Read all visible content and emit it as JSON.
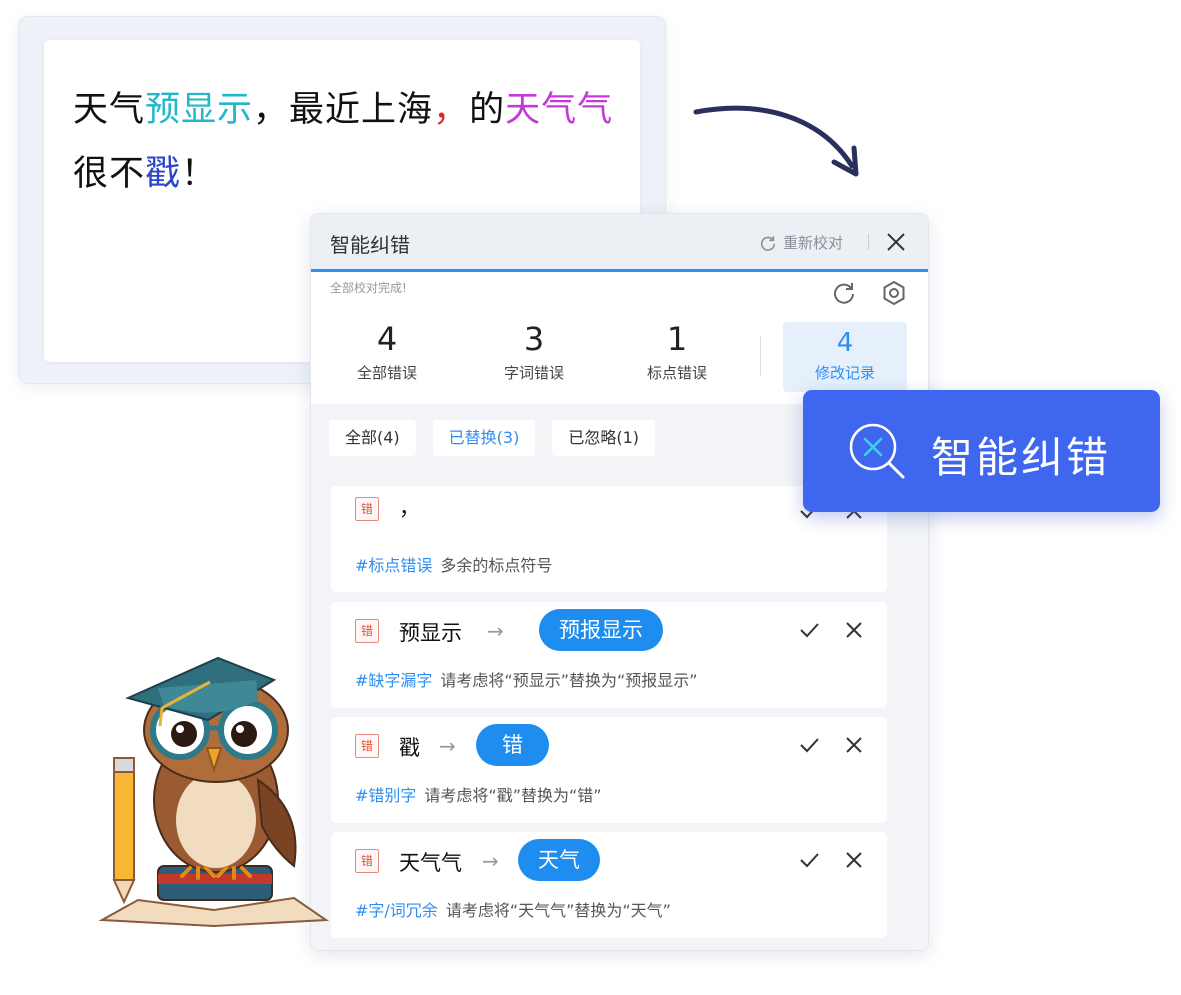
{
  "editor": {
    "seg1": "天气",
    "seg2": "预显示",
    "seg3": "，最近上海",
    "seg4": "，",
    "seg5": "的",
    "seg6": "天气气",
    "seg7": "很不",
    "seg8": "戳",
    "seg9": "！"
  },
  "panel": {
    "title": "智能纠错",
    "recheck_label": "重新校对",
    "status": "全部校对完成!",
    "stats": [
      {
        "num": "4",
        "label": "全部错误"
      },
      {
        "num": "3",
        "label": "字词错误"
      },
      {
        "num": "1",
        "label": "标点错误"
      },
      {
        "num": "4",
        "label": "修改记录"
      }
    ],
    "filters": [
      "全部(4)",
      "已替换(3)",
      "已忽略(1)"
    ],
    "items": [
      {
        "tag": "错",
        "original": "，",
        "suggestion": "",
        "category": "#标点错误",
        "description": "多余的标点符号"
      },
      {
        "tag": "错",
        "original": "预显示",
        "suggestion": "预报显示",
        "category": "#缺字漏字",
        "description": "请考虑将“预显示”替换为“预报显示”"
      },
      {
        "tag": "错",
        "original": "戳",
        "suggestion": "错",
        "category": "#错别字",
        "description": "请考虑将“戳”替换为“错”"
      },
      {
        "tag": "错",
        "original": "天气气",
        "suggestion": "天气",
        "category": "#字/词冗余",
        "description": "请考虑将“天气气”替换为“天气”"
      }
    ],
    "arrow_glyph": "→"
  },
  "badge": {
    "label": "智能纠错"
  },
  "colors": {
    "accent": "#2f8ff0",
    "badge": "#3f66ef",
    "error_tag": "#e0513f"
  }
}
